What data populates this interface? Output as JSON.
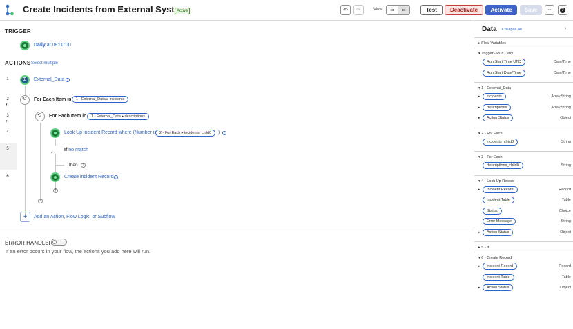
{
  "header": {
    "title": "Create Incidents from External System",
    "status": "Active",
    "view_label": "View:",
    "test_label": "Test",
    "deactivate_label": "Deactivate",
    "activate_label": "Activate",
    "save_label": "Save",
    "more_label": "•••"
  },
  "trigger": {
    "section_label": "TRIGGER",
    "name": "Daily",
    "time": "at 08:00:00"
  },
  "actions": {
    "section_label": "ACTIONS",
    "select_multiple": "Select multiple",
    "steps": [
      {
        "num": "1",
        "label": "External_Data"
      },
      {
        "num": "2",
        "label": "For Each Item in",
        "pill": "1 - External_Data ▸ incidents"
      },
      {
        "num": "3",
        "label": "For Each Item in",
        "pill": "1 - External_Data ▸ descriptions"
      },
      {
        "num": "4",
        "label": "Look Up incident Record where (Number is",
        "pill": "2 - For Each ▸ incidents_child0",
        "suffix": ")"
      },
      {
        "num": "5",
        "label": "If",
        "link": "no match",
        "then": "then"
      },
      {
        "num": "6",
        "label": "Create incident Record"
      }
    ],
    "add_label": "Add an Action, Flow Logic, or Subflow"
  },
  "error_handler": {
    "label": "ERROR HANDLER",
    "description": "If an error occurs in your flow, the actions you add here will run."
  },
  "data_panel": {
    "title": "Data",
    "collapse_all": "Collapse All",
    "groups": [
      {
        "label": "Flow Variables",
        "expanded": false,
        "items": []
      },
      {
        "label": "Trigger - Run Daily",
        "expanded": true,
        "items": [
          {
            "name": "Run Start Time UTC",
            "type": "Date/Time",
            "caret": false
          },
          {
            "name": "Run Start Date/Time",
            "type": "Date/Time",
            "caret": false
          }
        ]
      },
      {
        "label": "1 - External_Data",
        "expanded": true,
        "items": [
          {
            "name": "incidents",
            "type": "Array.String",
            "caret": true
          },
          {
            "name": "descriptions",
            "type": "Array.String",
            "caret": true
          },
          {
            "name": "Action Status",
            "type": "Object",
            "caret": true
          }
        ]
      },
      {
        "label": "2 - For Each",
        "expanded": true,
        "items": [
          {
            "name": "incidents_child0",
            "type": "String",
            "caret": false
          }
        ]
      },
      {
        "label": "3 - For Each",
        "expanded": true,
        "items": [
          {
            "name": "descriptions_child0",
            "type": "String",
            "caret": false
          }
        ]
      },
      {
        "label": "4 - Look Up Record",
        "expanded": true,
        "items": [
          {
            "name": "Incident Record",
            "type": "Record",
            "caret": true
          },
          {
            "name": "Incident Table",
            "type": "Table",
            "caret": false
          },
          {
            "name": "Status",
            "type": "Choice",
            "caret": false
          },
          {
            "name": "Error Message",
            "type": "String",
            "caret": false
          },
          {
            "name": "Action Status",
            "type": "Object",
            "caret": true
          }
        ]
      },
      {
        "label": "5 - If",
        "expanded": false,
        "items": []
      },
      {
        "label": "6 - Create Record",
        "expanded": true,
        "items": [
          {
            "name": "incident Record",
            "type": "Record",
            "caret": true
          },
          {
            "name": "incident Table",
            "type": "Table",
            "caret": false
          },
          {
            "name": "Action Status",
            "type": "Object",
            "caret": true
          }
        ]
      }
    ]
  }
}
